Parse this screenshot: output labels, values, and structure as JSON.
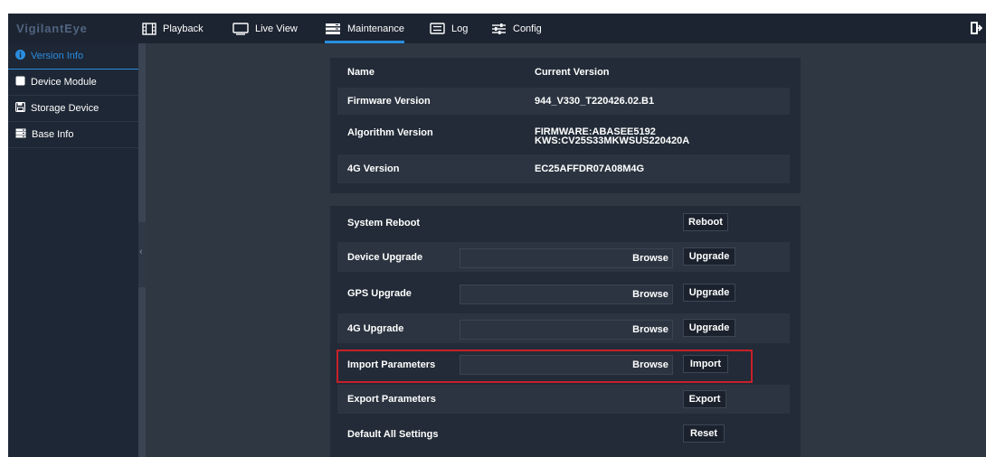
{
  "app": {
    "brand": "VigilantEye"
  },
  "nav": {
    "playback": "Playback",
    "live_view": "Live View",
    "maintenance": "Maintenance",
    "log": "Log",
    "config": "Config",
    "active": "maintenance"
  },
  "sidebar": {
    "items": [
      {
        "label": "Version Info",
        "icon": "info-icon",
        "active": true
      },
      {
        "label": "Device Module",
        "icon": "square-icon",
        "active": false
      },
      {
        "label": "Storage Device",
        "icon": "floppy-icon",
        "active": false
      },
      {
        "label": "Base Info",
        "icon": "server-icon",
        "active": false
      }
    ]
  },
  "version": {
    "header_name": "Name",
    "header_version": "Current Version",
    "rows": [
      {
        "name": "Firmware Version",
        "value": "944_V330_T220426.02.B1"
      },
      {
        "name": "Algorithm Version",
        "value_line1": "FIRMWARE:ABASEE5192",
        "value_line2": "KWS:CV25S33MKWSUS220420A"
      },
      {
        "name": "4G Version",
        "value": "EC25AFFDR07A08M4G"
      }
    ]
  },
  "maintenance": {
    "system_reboot": {
      "label": "System Reboot",
      "button": "Reboot"
    },
    "device_upgrade": {
      "label": "Device Upgrade",
      "browse": "Browse",
      "button": "Upgrade"
    },
    "gps_upgrade": {
      "label": "GPS Upgrade",
      "browse": "Browse",
      "button": "Upgrade"
    },
    "g4_upgrade": {
      "label": "4G Upgrade",
      "browse": "Browse",
      "button": "Upgrade"
    },
    "import_params": {
      "label": "Import Parameters",
      "browse": "Browse",
      "button": "Import"
    },
    "export_params": {
      "label": "Export Parameters",
      "button": "Export"
    },
    "default_settings": {
      "label": "Default All Settings",
      "button": "Reset"
    }
  },
  "colors": {
    "accent": "#2a8de0",
    "highlight_border": "#c8202a",
    "topbar": "#1c2431",
    "content_bg": "#2e3742"
  }
}
